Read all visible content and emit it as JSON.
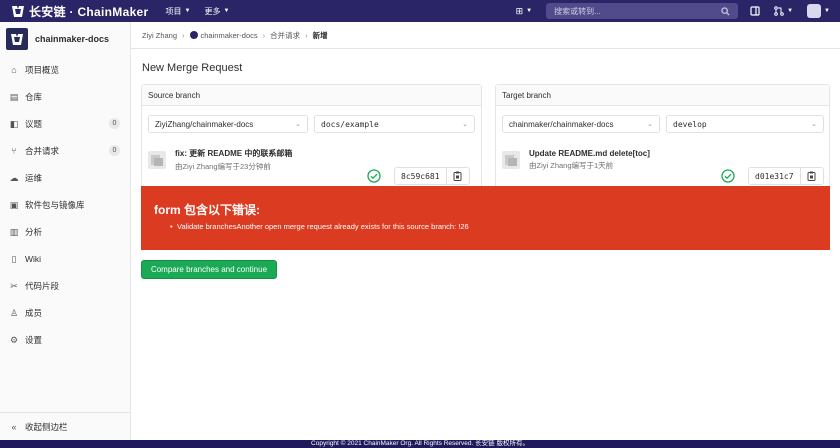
{
  "topbar": {
    "brand": "长安链 · ChainMaker",
    "nav": [
      {
        "label": "项目"
      },
      {
        "label": "更多"
      }
    ],
    "search_placeholder": "搜索或转到..."
  },
  "sidebar": {
    "project_name": "chainmaker-docs",
    "items": [
      {
        "label": "项目概览",
        "icon": "home-icon"
      },
      {
        "label": "仓库",
        "icon": "doc-icon"
      },
      {
        "label": "议题",
        "icon": "issues-icon",
        "count": "0"
      },
      {
        "label": "合并请求",
        "icon": "merge-icon",
        "count": "0"
      },
      {
        "label": "运维",
        "icon": "rocket-icon"
      },
      {
        "label": "软件包与镜像库",
        "icon": "package-icon"
      },
      {
        "label": "分析",
        "icon": "chart-icon"
      },
      {
        "label": "Wiki",
        "icon": "book-icon"
      },
      {
        "label": "代码片段",
        "icon": "scissors-icon"
      },
      {
        "label": "成员",
        "icon": "users-icon"
      },
      {
        "label": "设置",
        "icon": "gear-icon"
      }
    ],
    "collapse_label": "收起侧边栏"
  },
  "breadcrumb": {
    "items": [
      "Ziyi Zhang",
      "chainmaker-docs",
      "合并请求"
    ],
    "current": "新增"
  },
  "page": {
    "title": "New Merge Request"
  },
  "source": {
    "header": "Source branch",
    "project": "ZiyiZhang/chainmaker-docs",
    "branch": "docs/example",
    "commit_title": "fix: 更新 README 中的联系邮箱",
    "commit_meta": "由Ziyi Zhang编写于23分钟前",
    "sha": "8c59c681"
  },
  "target": {
    "header": "Target branch",
    "project": "chainmaker/chainmaker-docs",
    "branch": "develop",
    "commit_title": "Update README.md delete[toc]",
    "commit_meta": "由Ziyi Zhang编写于1天前",
    "sha": "d01e31c7"
  },
  "alert": {
    "title": "form 包含以下错误:",
    "errors": [
      "Validate branchesAnother open merge request already exists for this source branch: !26"
    ]
  },
  "actions": {
    "compare_label": "Compare branches and continue"
  },
  "footer": {
    "text": "Copyright © 2021 ChainMaker Org. All Rights Reserved. 长安链 版权所有。"
  },
  "colors": {
    "topbar": "#2a2566",
    "error": "#db3b21",
    "success": "#1aaa55"
  }
}
